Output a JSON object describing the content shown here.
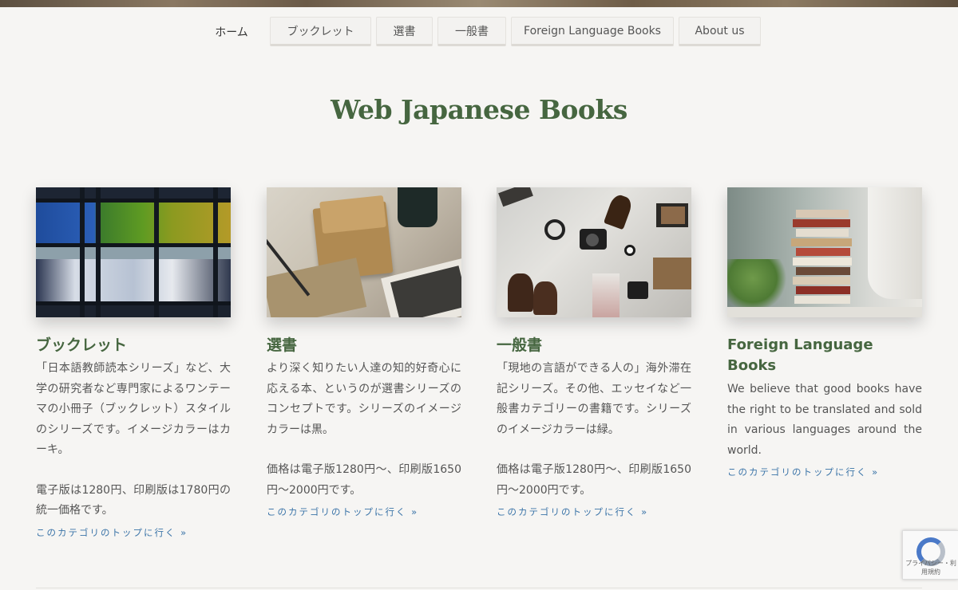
{
  "nav": {
    "items": [
      {
        "label": "ホーム"
      },
      {
        "label": "ブックレット"
      },
      {
        "label": "選書"
      },
      {
        "label": "一般書"
      },
      {
        "label": "Foreign Language Books"
      },
      {
        "label": "About us"
      }
    ]
  },
  "site_title": "Web Japanese Books",
  "cards": [
    {
      "title": "ブックレット",
      "paragraphs": [
        "「日本語教師読本シリーズ」など、大学の研究者など専門家によるワンテーマの小冊子（ブックレット）スタイルのシリーズです。イメージカラーはカーキ。",
        "電子版は1280円、印刷版は1780円の統一価格です。"
      ],
      "link": "このカテゴリのトップに行く »"
    },
    {
      "title": "選書",
      "paragraphs": [
        "より深く知りたい人達の知的好奇心に応える本、というのが選書シリーズのコンセプトです。シリーズのイメージカラーは黒。",
        "価格は電子版1280円～、印刷版1650円～2000円です。"
      ],
      "link": "このカテゴリのトップに行く »"
    },
    {
      "title": "一般書",
      "paragraphs": [
        "「現地の言語ができる人の」海外滞在記シリーズ。その他、エッセイなど一般書カテゴリーの書籍です。シリーズのイメージカラーは緑。",
        "価格は電子版1280円～、印刷版1650円～2000円です。"
      ],
      "link": "このカテゴリのトップに行く »"
    },
    {
      "title": "Foreign Language Books",
      "paragraphs": [
        "We believe that good books have the right to be translated and sold in various languages around the world."
      ],
      "link": "このカテゴリのトップに行く »"
    }
  ],
  "recaptcha": {
    "text": "プライバシー・利用規約"
  },
  "colors": {
    "accent_green": "#466640",
    "link_blue": "#3b74a8",
    "background": "#f6f5f3"
  }
}
